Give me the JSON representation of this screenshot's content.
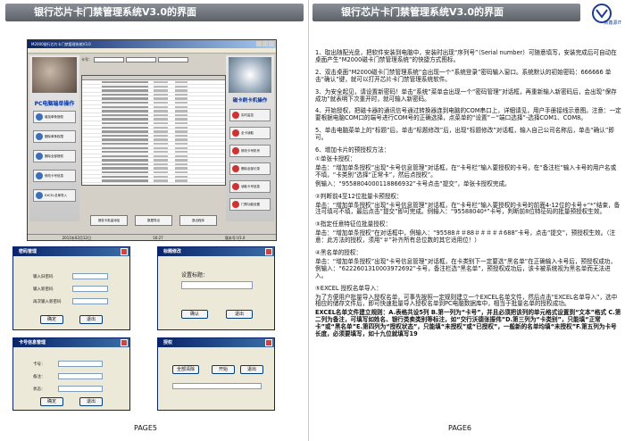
{
  "left_page": {
    "banner": "银行芯片卡门禁管理系统V3.0的界面",
    "page_number": "PAGE5",
    "app_window": {
      "title": "M2000银行芯片卡门禁管理系统V3.0",
      "card_label": "卡号：",
      "left_panel_title": "PC电脑端单操作",
      "left_buttons": [
        "增加单条授权",
        "删除单条权限",
        "删除全部授权",
        "修改卡号信息",
        "EXCEL总单导入"
      ],
      "right_panel_title": "磁卡刷卡机操作",
      "right_buttons": [
        "实时监控",
        "全卡读取",
        "修改卡号机号",
        "删除全部记录",
        "读取卡号信息",
        "门禁功能设置"
      ],
      "bottom_buttons": [
        "授权卡批量添加",
        "数据导出",
        "退出程序"
      ],
      "status": [
        "2011年02月12日",
        "16:27",
        "版本号:V3.0"
      ]
    },
    "dialogs": [
      {
        "title": "密码管理",
        "labels": [
          "输入旧密码",
          "输入新密码",
          "再次输入新密码"
        ],
        "buttons": [
          "确定",
          "退出"
        ]
      },
      {
        "title": "标题修改",
        "labels": [
          "设置标题："
        ],
        "buttons": [
          "确认",
          "退出"
        ]
      },
      {
        "title": "卡号信息管理",
        "labels": [
          "卡号：",
          "备注：",
          "状态："
        ],
        "buttons": [
          "确定",
          "退出"
        ]
      },
      {
        "title": "授权",
        "labels": [
          "全部清除"
        ],
        "buttons": [
          "开始",
          "退出"
        ]
      }
    ]
  },
  "right_page": {
    "banner": "银行芯片卡门禁管理系统V3.0的界面",
    "page_number": "PAGE6",
    "logo_text": "新鑫源IT",
    "paragraphs": [
      "1、取出随配光盘，把软件安装到电脑中，安装时出现“序列号”（Serial number）可随意填写，安装完成后可自动在桌面产生“M2000磁卡门禁管理系统”的快捷方式图标。",
      "2、双击桌面“M2000磁卡门禁管理系统”会出现一个“系统登录”密码输入窗口。系统默认的初始密码：666666  单击“确认”键，就可以打开芯片卡门禁管理系统软件。",
      "3、为安全起见，请设置新密码！单击“系统”菜单会出现一个“密码管理”对话框，再重新输入新密码后，会出现“保存成功”就表明下次重开时，就可输入新密码。",
      "4、开始授权，把磁卡器的通讯信号通过转换器连到电脑的COM串口上，详细请见，用户手册接线示意图。注意：一定要根据电脑COM口的端号进行COM号的正确选择，点菜单的“设置”－“端口选择”-选择COM1、COM8。",
      "5、单击电脑菜单上的“标题”后，单击“标题修改”后，出现“标题修改”对话框，输入自己公司名称后，单击“确认”即可。",
      "6、增加卡片的预授权方法：",
      "①单张卡授权：",
      "单击：“增加单条授权”出现“卡号信息管理”对话框，在“卡号栏”输入要授权的卡号，在“备注栏”输入卡号的用户名或不填，“卡类别”选择“正常卡”，然后点授权”。",
      "例输入：“9558804000118866932”卡号点击“提交”，单张卡授权完成。",
      "②判断前4至12位批量卡预授权：",
      "单击：“增加单条授权”出现“卡号信息管理”对话框，在“卡号栏”输入要授权的卡号的前面4-12位的卡号+“*”结束，备注可填可不填，最后点击“提交”即可完成。例输入：“95588040*”卡号，判断前8位特征码的批量预授权生效。",
      "③指定任意特征位批量授权：",
      "单击：“增加单条授权”在对话框中，例输入：“95588＃＃88＃＃＃＃＃688”卡号，点击“提交”，预授权生效。（注意：此方法的授权，须用“＃”补齐所有总位数的其它适用位！）",
      "④黑名单的授权：",
      "单击：“增加单条授权”出现“卡号信息管理”对话框，在卡类别下一定要选“黑名单”在正确输入卡号后，预授权成功，例输入：“6222601310003972692”卡号，备注栏选“黑名单”，预授权成功后，该卡被系统视为黑名单而无法进入。",
      "⑤EXCEL 授权名单导入：",
      "为了方便用户批量导入授权名单，可事先按照一定规则建立一个EXCEL名单文件，然后点击“EXCEL名单导入”，选中相应的储存文件后，即可快速批量导入授权名单到PC电脑数据库中，相当于批量名单的授权成功。",
      "EXCEL名单文件建立规则：A.表格共设5列 B.第一列为“卡号”，并且必须把该列的单元格式设置到“文本”格式 C.第二列为备注，可填写如姓名、银行类卖类别等标注，如“交行沃德张振伟”D.第三列为“卡类别”，只能填“正常卡”或“黑名单”E.第四列为“授权状态”，只能填“未授权”或“已授权”，一般新的名单均填“未授权”F.第五列为卡号长度，必须要填写，如十九位就填写19"
    ]
  }
}
